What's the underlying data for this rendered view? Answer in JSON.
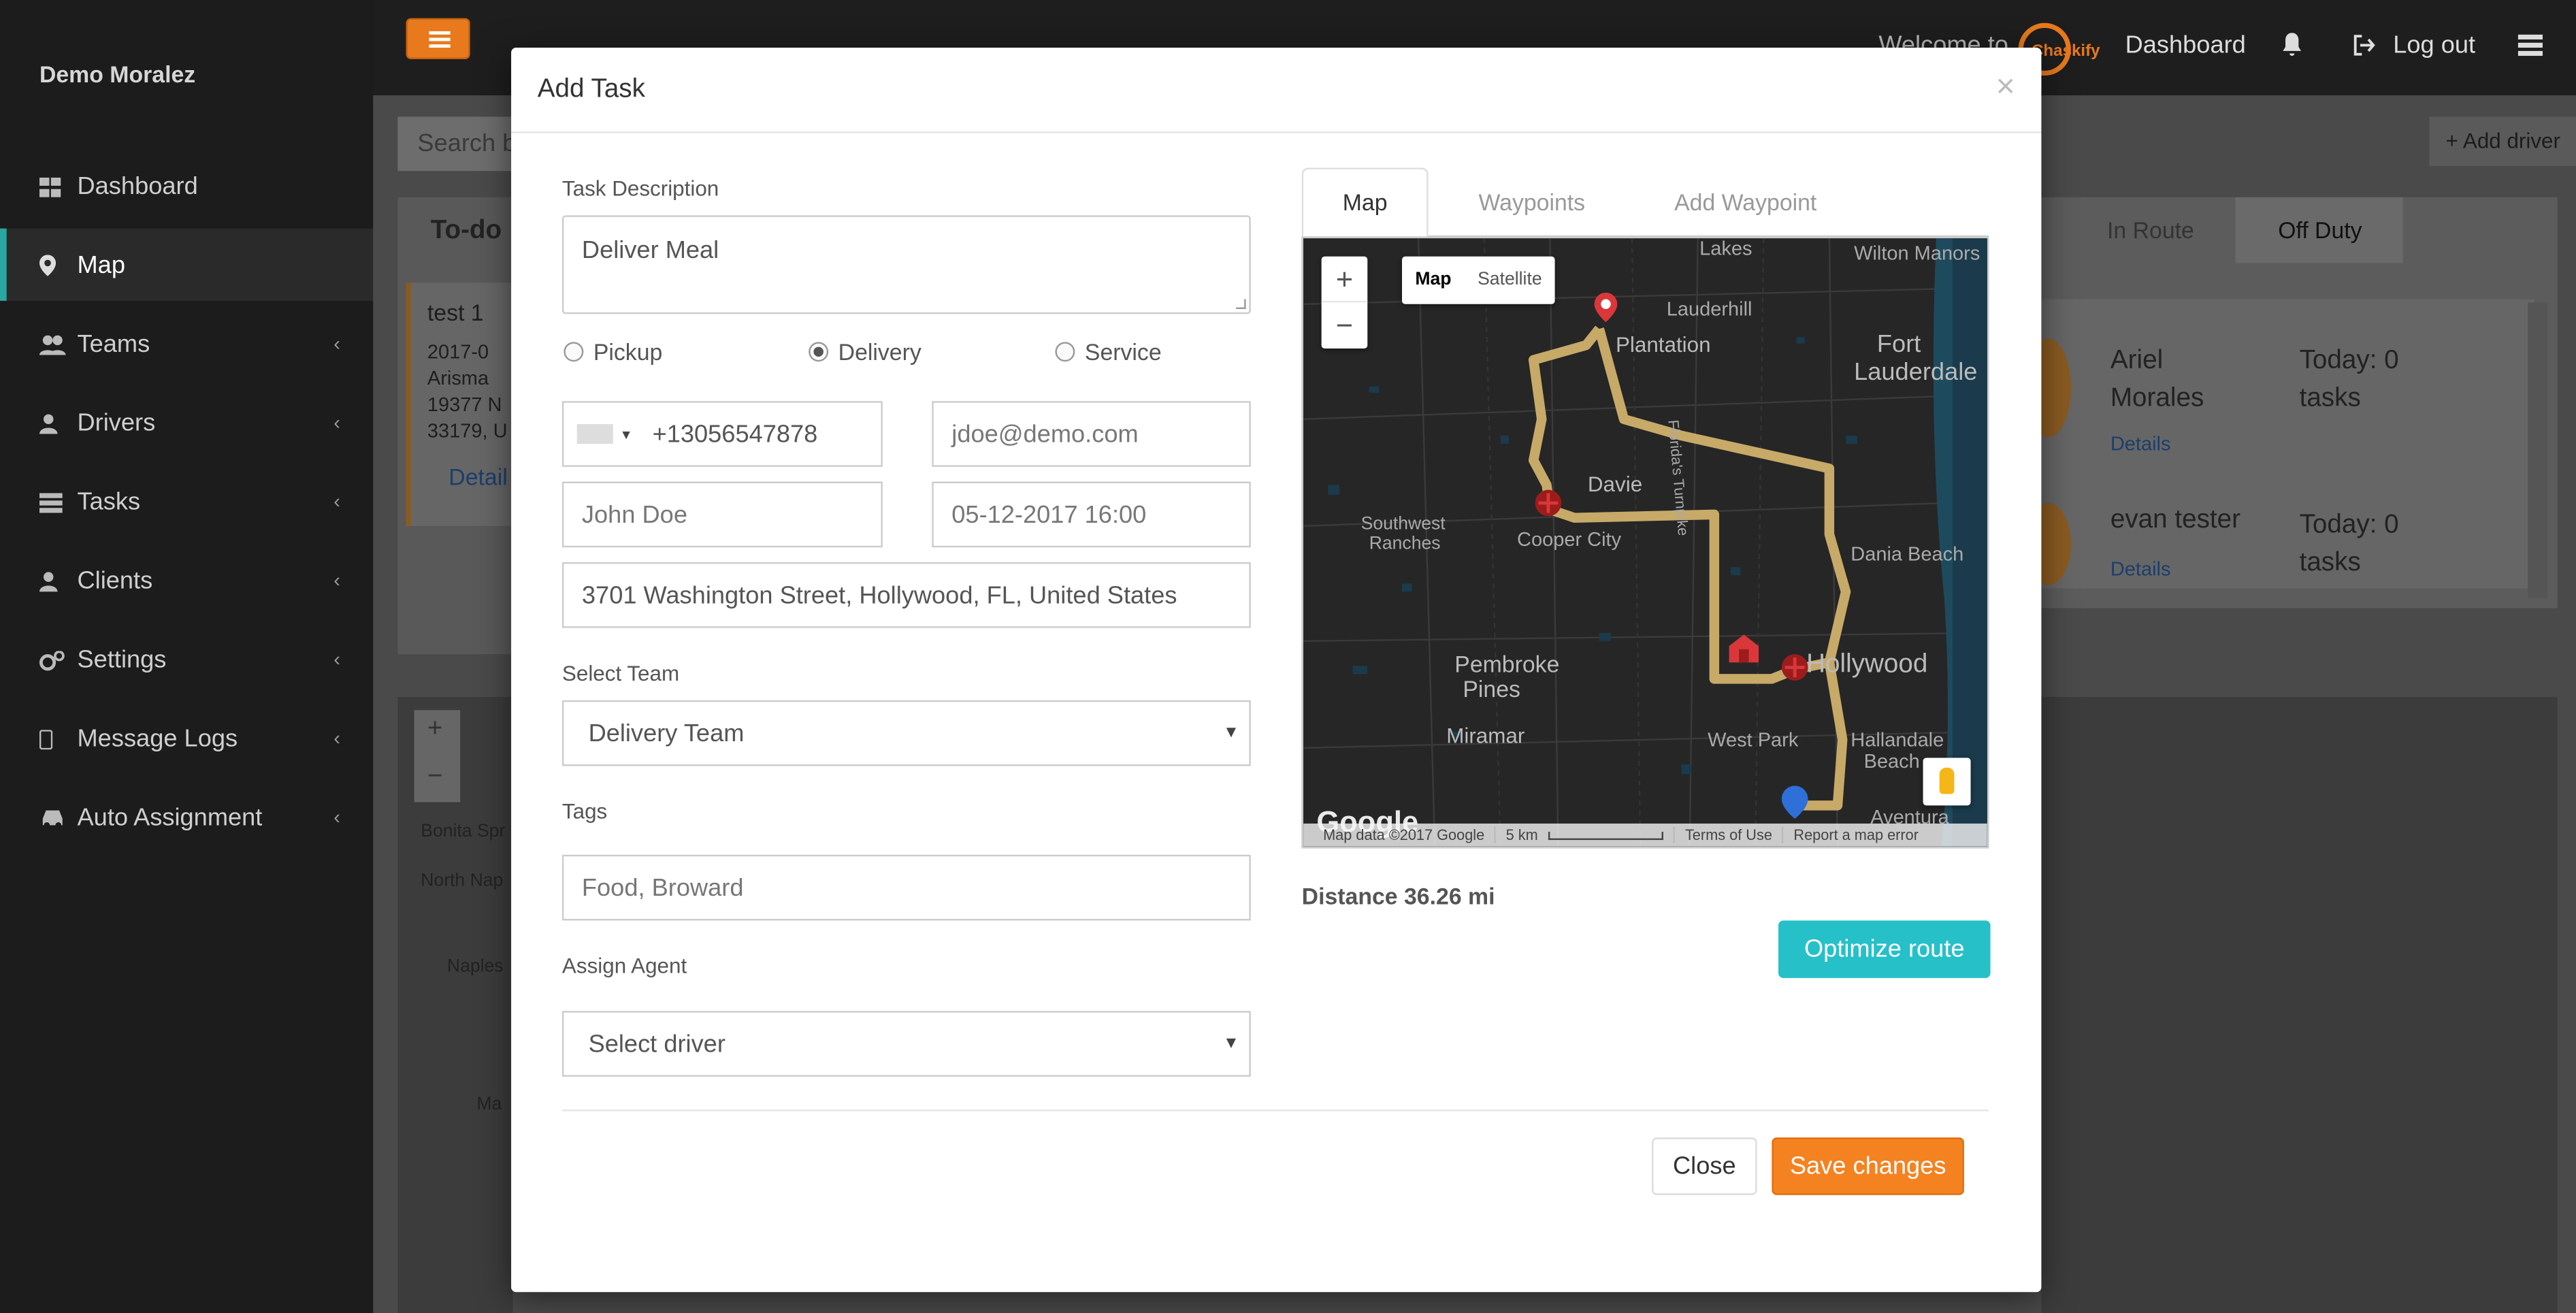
{
  "sidebar": {
    "user_name": "Demo Moralez",
    "items": [
      {
        "label": "Dashboard",
        "icon": "dashboard-icon",
        "active": false,
        "chevron": false
      },
      {
        "label": "Map",
        "icon": "map-marker-icon",
        "active": true,
        "chevron": false
      },
      {
        "label": "Teams",
        "icon": "users-icon",
        "active": false,
        "chevron": true
      },
      {
        "label": "Drivers",
        "icon": "user-icon",
        "active": false,
        "chevron": true
      },
      {
        "label": "Tasks",
        "icon": "tasks-icon",
        "active": false,
        "chevron": true
      },
      {
        "label": "Clients",
        "icon": "user-icon",
        "active": false,
        "chevron": true
      },
      {
        "label": "Settings",
        "icon": "cogs-icon",
        "active": false,
        "chevron": true
      },
      {
        "label": "Message Logs",
        "icon": "mobile-icon",
        "active": false,
        "chevron": true
      },
      {
        "label": "Auto Assignment",
        "icon": "car-icon",
        "active": false,
        "chevron": true
      }
    ],
    "chevron_glyph": "‹"
  },
  "topbar": {
    "welcome": "Welcome to",
    "brand": "Chaskify",
    "dashboard_link": "Dashboard",
    "logout": "Log out"
  },
  "background": {
    "search_placeholder": "Search b",
    "add_driver": "Add driver",
    "todo": "To-do",
    "task_card": {
      "title": "test 1",
      "line1": "2017-0",
      "line2": "Arisma",
      "line3": "19377 N",
      "line4": "33179, U",
      "details": "Detail"
    },
    "tab_in_route": "In Route",
    "tab_off_duty": "Off Duty",
    "drivers": [
      {
        "name_line1": "Ariel",
        "name_line2": "Morales",
        "today_line1": "Today: 0",
        "today_line2": "tasks",
        "details": "Details"
      },
      {
        "name_line1": "evan tester",
        "name_line2": "",
        "today_line1": "Today: 0",
        "today_line2": "tasks",
        "details": "Details"
      }
    ],
    "map_labels": [
      "Bonita Spr",
      "North Nap",
      "Naples",
      "Ma"
    ]
  },
  "modal": {
    "title": "Add Task",
    "close_glyph": "×",
    "task_description_label": "Task Description",
    "task_description": "Deliver Meal",
    "task_types": [
      {
        "label": "Pickup",
        "checked": false
      },
      {
        "label": "Delivery",
        "checked": true
      },
      {
        "label": "Service",
        "checked": false
      }
    ],
    "phone": "+13056547878",
    "email_placeholder": "jdoe@demo.com",
    "name_placeholder": "John Doe",
    "datetime_placeholder": "05-12-2017 16:00",
    "address": "3701 Washington Street, Hollywood, FL, United States",
    "select_team_label": "Select Team",
    "team_selected": "Delivery Team",
    "tags_label": "Tags",
    "tags_placeholder": "Food, Broward",
    "assign_agent_label": "Assign Agent",
    "agent_selected": "Select driver",
    "tabs": [
      "Map",
      "Waypoints",
      "Add Waypoint"
    ],
    "map": {
      "type_buttons": [
        "Map",
        "Satellite"
      ],
      "zoom_in": "+",
      "zoom_out": "−",
      "labels": [
        "Lakes",
        "Wilton Manors",
        "Lauderhill",
        "Plantation",
        "Fort",
        "Lauderdale",
        "Davie",
        "Southwest",
        "Ranches",
        "Cooper City",
        "Dania Beach",
        "Pembroke",
        "Pines",
        "Hollywood",
        "Miramar",
        "West Park",
        "Hallandale",
        "Beach",
        "Aventura",
        "Florida's Turnpike"
      ],
      "footer": [
        "Map data ©2017 Google",
        "5 km",
        "Terms of Use",
        "Report a map error"
      ],
      "logo": "Google"
    },
    "distance": "Distance 36.26 mi",
    "optimize_button": "Optimize route",
    "close_button": "Close",
    "save_button": "Save changes"
  },
  "colors": {
    "accent_orange": "#f58220",
    "teal": "#26c0c8",
    "route": "#c7a968",
    "marker_red": "#d9373a"
  }
}
